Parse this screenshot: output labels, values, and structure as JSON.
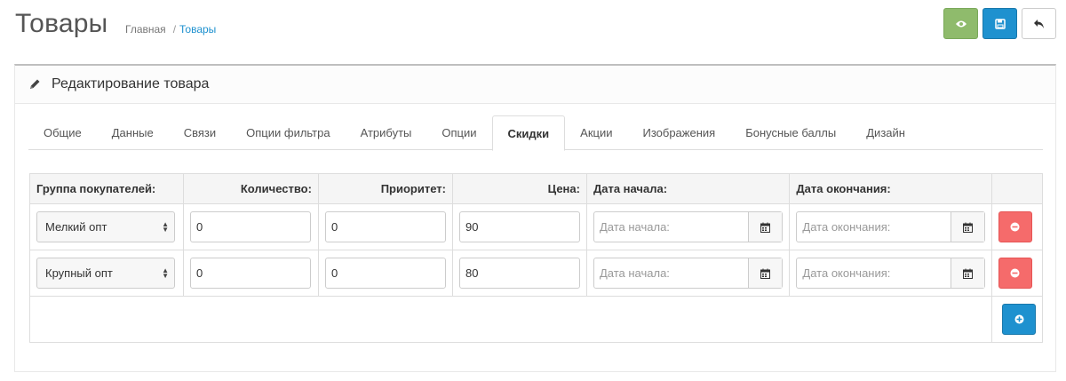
{
  "header": {
    "title": "Товары",
    "breadcrumb": [
      {
        "label": "Главная"
      },
      {
        "label": "Товары"
      }
    ],
    "breadcrumb_sep": "/",
    "buttons": [
      {
        "name": "preview-button",
        "icon": "eye-icon",
        "color": "#8fbb6c"
      },
      {
        "name": "save-button",
        "icon": "save-icon",
        "color": "#1e91cf"
      },
      {
        "name": "back-button",
        "icon": "reply-icon",
        "color": "#ffffff"
      }
    ]
  },
  "panel": {
    "title": "Редактирование товара",
    "icon": "pencil-icon"
  },
  "tabs": [
    {
      "label": "Общие"
    },
    {
      "label": "Данные"
    },
    {
      "label": "Связи"
    },
    {
      "label": "Опции фильтра"
    },
    {
      "label": "Атрибуты"
    },
    {
      "label": "Опции"
    },
    {
      "label": "Скидки",
      "active": true
    },
    {
      "label": "Акции"
    },
    {
      "label": "Изображения"
    },
    {
      "label": "Бонусные баллы"
    },
    {
      "label": "Дизайн"
    }
  ],
  "table": {
    "columns": {
      "group": "Группа покупателей:",
      "quantity": "Количество:",
      "priority": "Приоритет:",
      "price": "Цена:",
      "date_start": "Дата начала:",
      "date_end": "Дата окончания:"
    },
    "rows": [
      {
        "group": "Мелкий опт",
        "quantity": "0",
        "priority": "0",
        "price": "90",
        "date_start_placeholder": "Дата начала:",
        "date_end_placeholder": "Дата окончания:"
      },
      {
        "group": "Крупный опт",
        "quantity": "0",
        "priority": "0",
        "price": "80",
        "date_start_placeholder": "Дата начала:",
        "date_end_placeholder": "Дата окончания:"
      }
    ]
  },
  "colors": {
    "accent": "#1e91cf",
    "success": "#8fbb6c",
    "danger": "#f56b6b"
  }
}
